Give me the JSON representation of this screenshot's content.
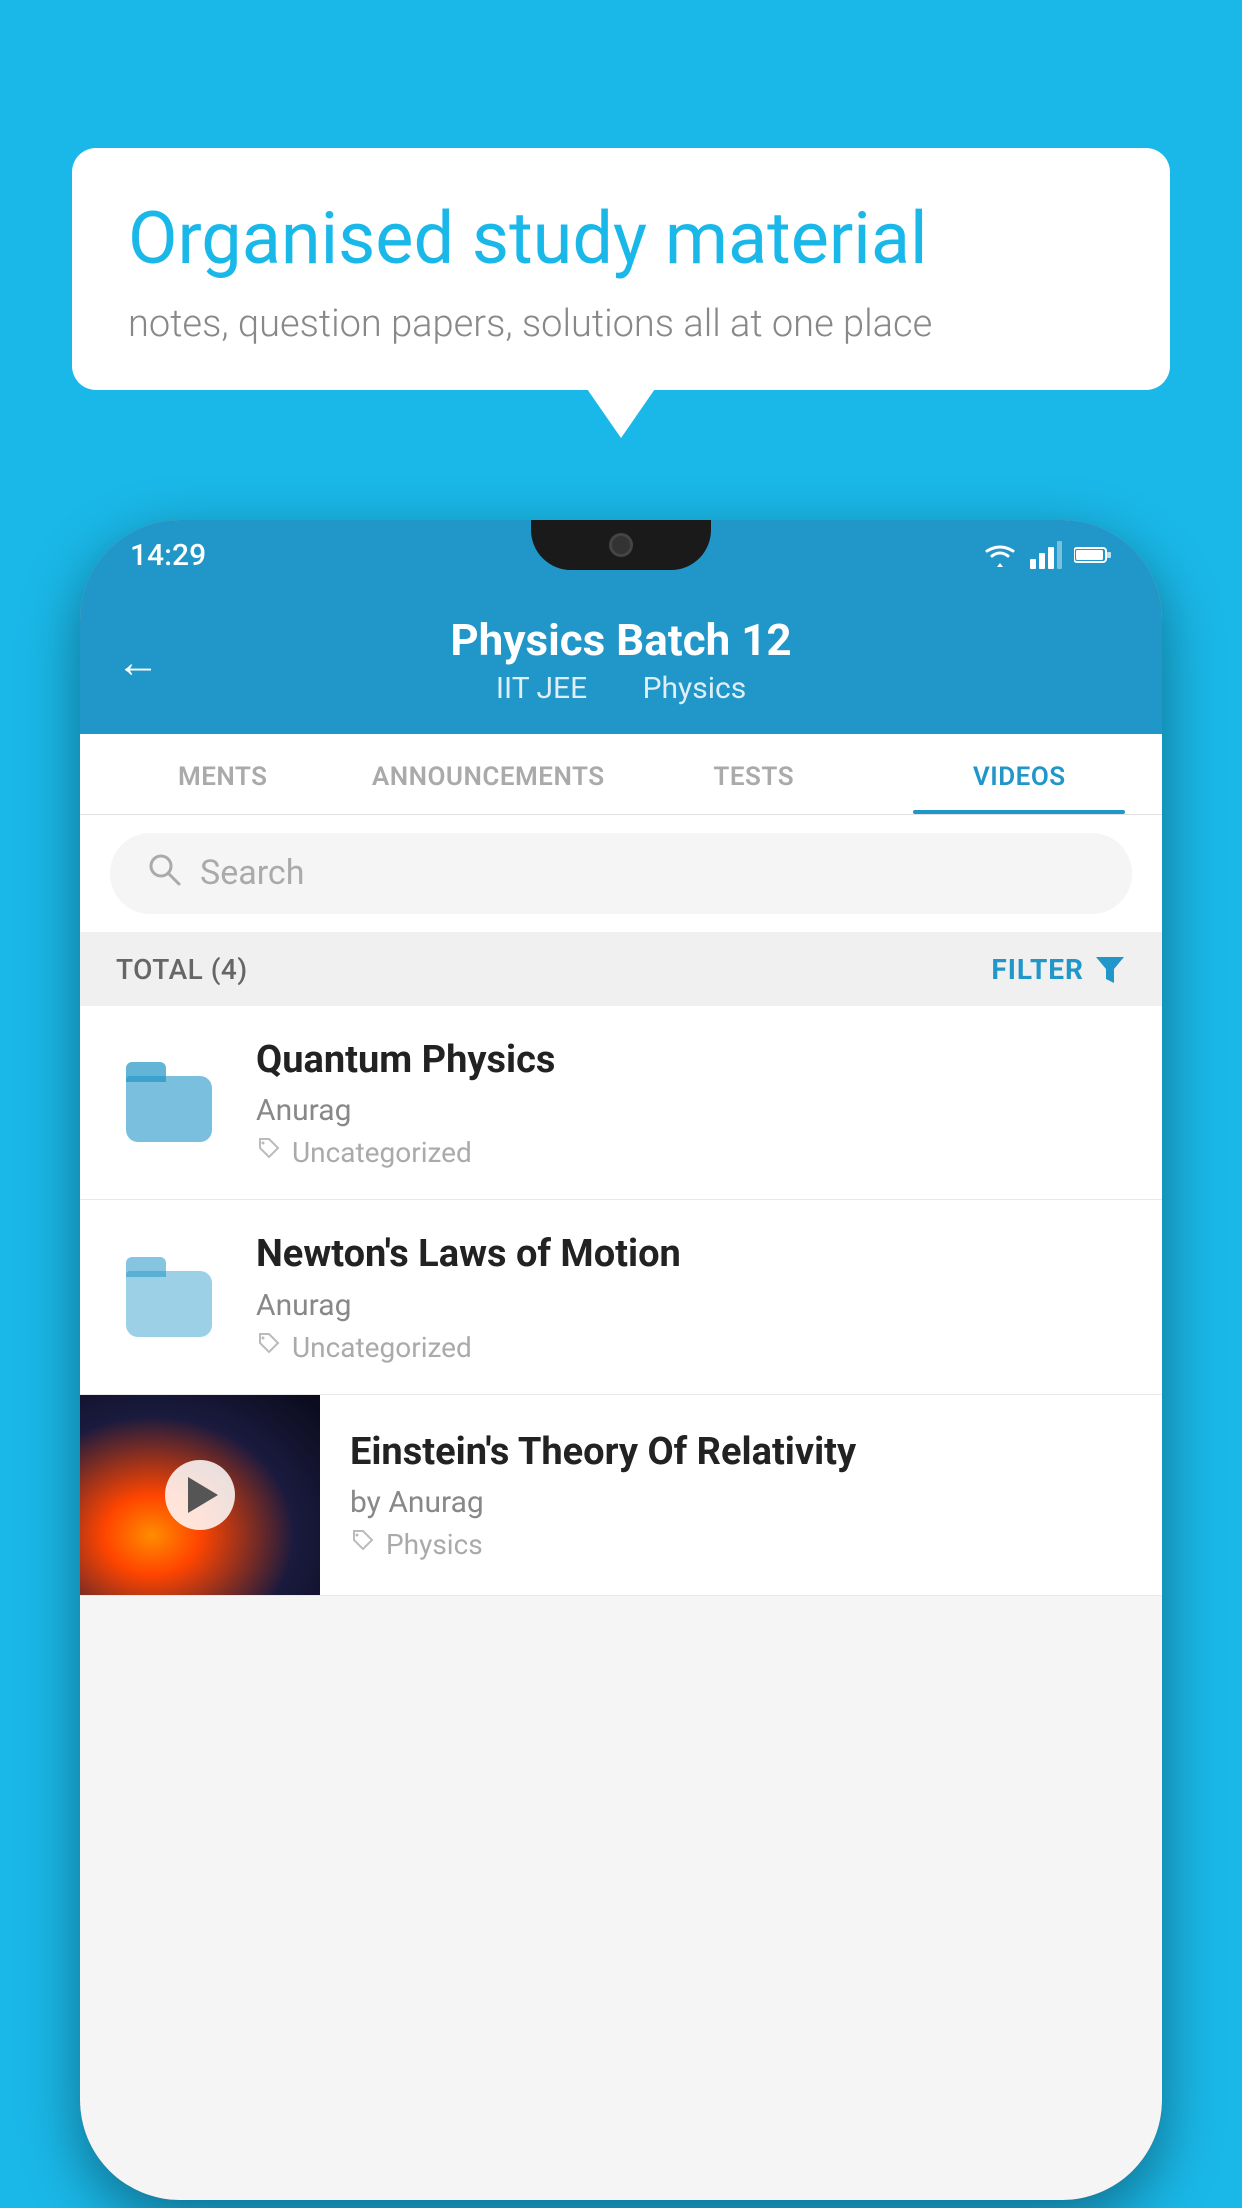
{
  "background_color": "#1ab8e8",
  "bubble": {
    "title": "Organised study material",
    "subtitle": "notes, question papers, solutions all at one place"
  },
  "phone": {
    "status_bar": {
      "time": "14:29",
      "icons": [
        "wifi",
        "signal",
        "battery"
      ]
    },
    "header": {
      "title": "Physics Batch 12",
      "subtitle_part1": "IIT JEE",
      "subtitle_part2": "Physics",
      "back_label": "←"
    },
    "tabs": [
      {
        "label": "MENTS",
        "active": false
      },
      {
        "label": "ANNOUNCEMENTS",
        "active": false
      },
      {
        "label": "TESTS",
        "active": false
      },
      {
        "label": "VIDEOS",
        "active": true
      }
    ],
    "search": {
      "placeholder": "Search"
    },
    "filter_bar": {
      "total_label": "TOTAL (4)",
      "filter_label": "FILTER"
    },
    "video_items": [
      {
        "type": "folder",
        "title": "Quantum Physics",
        "author": "Anurag",
        "tag": "Uncategorized"
      },
      {
        "type": "folder",
        "title": "Newton's Laws of Motion",
        "author": "Anurag",
        "tag": "Uncategorized"
      },
      {
        "type": "video",
        "title": "Einstein's Theory Of Relativity",
        "author": "by Anurag",
        "tag": "Physics"
      }
    ]
  }
}
